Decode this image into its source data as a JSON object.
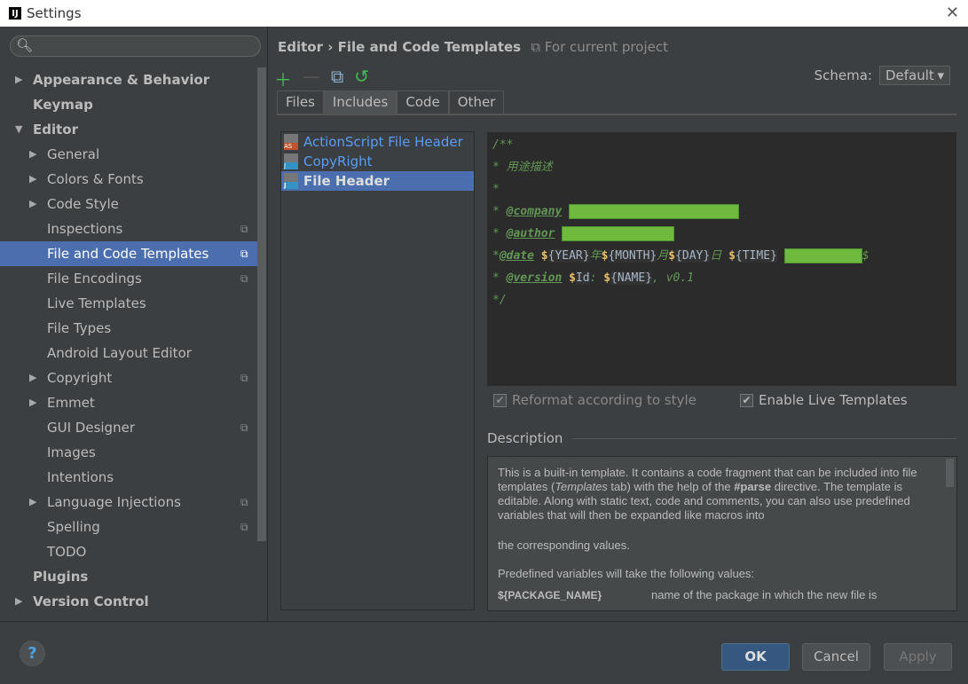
{
  "window": {
    "title": "Settings",
    "icon": "IJ"
  },
  "sidebar": {
    "items": [
      {
        "label": "Appearance & Behavior",
        "level": 0,
        "bold": true,
        "arrow": "▶"
      },
      {
        "label": "Keymap",
        "level": 0,
        "bold": true
      },
      {
        "label": "Editor",
        "level": 0,
        "bold": true,
        "arrow": "▼"
      },
      {
        "label": "General",
        "level": 1,
        "arrow": "▶"
      },
      {
        "label": "Colors & Fonts",
        "level": 1,
        "arrow": "▶"
      },
      {
        "label": "Code Style",
        "level": 1,
        "arrow": "▶"
      },
      {
        "label": "Inspections",
        "level": 1,
        "proj": true
      },
      {
        "label": "File and Code Templates",
        "level": 1,
        "proj": true,
        "selected": true
      },
      {
        "label": "File Encodings",
        "level": 1,
        "proj": true
      },
      {
        "label": "Live Templates",
        "level": 1
      },
      {
        "label": "File Types",
        "level": 1
      },
      {
        "label": "Android Layout Editor",
        "level": 1
      },
      {
        "label": "Copyright",
        "level": 1,
        "arrow": "▶",
        "proj": true
      },
      {
        "label": "Emmet",
        "level": 1,
        "arrow": "▶"
      },
      {
        "label": "GUI Designer",
        "level": 1,
        "proj": true
      },
      {
        "label": "Images",
        "level": 1
      },
      {
        "label": "Intentions",
        "level": 1
      },
      {
        "label": "Language Injections",
        "level": 1,
        "arrow": "▶",
        "proj": true
      },
      {
        "label": "Spelling",
        "level": 1,
        "proj": true
      },
      {
        "label": "TODO",
        "level": 1
      },
      {
        "label": "Plugins",
        "level": 0,
        "bold": true
      },
      {
        "label": "Version Control",
        "level": 0,
        "bold": true,
        "arrow": "▶"
      }
    ]
  },
  "breadcrumb": {
    "parent": "Editor",
    "sep": "›",
    "current": "File and Code Templates",
    "scope": "For current project"
  },
  "schema": {
    "label": "Schema:",
    "value": "Default"
  },
  "tabs": [
    "Files",
    "Includes",
    "Code",
    "Other"
  ],
  "templates": [
    {
      "name": "ActionScript File Header",
      "badge": "AS",
      "color": "#c0532b"
    },
    {
      "name": "CopyRight",
      "badge": "J",
      "color": "#3592c4"
    },
    {
      "name": "File Header",
      "badge": "J",
      "color": "#3592c4",
      "selected": true
    }
  ],
  "code": {
    "l1": "/**",
    "l2": "* 用途描述",
    "l3": "*",
    "star": "* ",
    "company": "@company",
    "author": "@author",
    "date": "@date",
    "version": "@version",
    "year": "{YEAR}",
    "nian": "年",
    "month": "{MONTH}",
    "yue": "月",
    "day": "{DAY}",
    "ri": "日",
    "time": "{TIME}",
    "dollar": "$",
    "id": "Id",
    "colon": ": ",
    "name": "{NAME}",
    "ver": ", v0.1",
    "end": "*/"
  },
  "options": {
    "reformat": "Reformat according to style",
    "live": "Enable Live Templates"
  },
  "description": {
    "title": "Description",
    "p1a": "This is a built-in template. It contains a code fragment that can be included into file templates (",
    "p1i": "Templates",
    "p1b": " tab) with the help of the ",
    "p1c": "#parse",
    "p1d": " directive. The template is editable. Along with static text, code and comments, you can also use predefined variables that will then be expanded like macros into",
    "p2": "the corresponding values.",
    "p3": "Predefined variables will take the following values:",
    "var": "${PACKAGE_NAME}",
    "vardesc": "name of the package in which the new file is"
  },
  "footer": {
    "help": "?",
    "ok": "OK",
    "cancel": "Cancel",
    "apply": "Apply"
  }
}
